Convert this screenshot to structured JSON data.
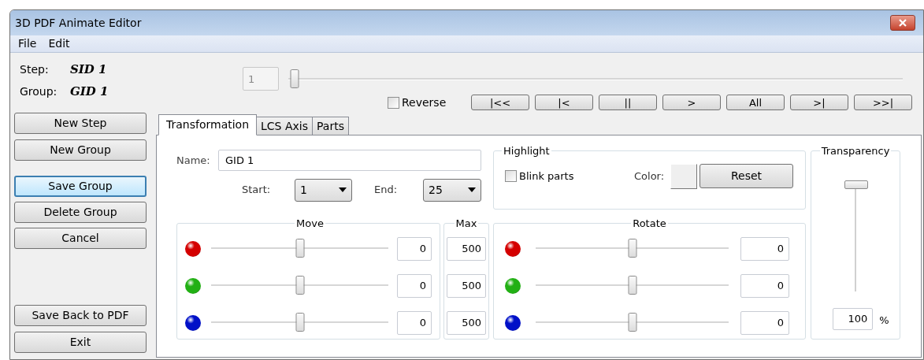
{
  "window": {
    "title": "3D PDF Animate Editor"
  },
  "menu": [
    "File",
    "Edit"
  ],
  "info": [
    {
      "label": "Step:",
      "value": "SID 1"
    },
    {
      "label": "Group:",
      "value": "GID 1"
    }
  ],
  "step": {
    "value": "1",
    "disabled": true,
    "level": 0
  },
  "reverse": {
    "label": "Reverse",
    "checked": false
  },
  "playback_buttons": [
    "|<<",
    "|<",
    "||",
    ">",
    "All",
    ">|",
    ">>|"
  ],
  "actions_top": [
    {
      "label": "New Step",
      "focused": false
    },
    {
      "label": "New Group",
      "focused": false
    }
  ],
  "actions_middle": [
    {
      "label": "Save Group",
      "focused": true
    },
    {
      "label": "Delete Group",
      "focused": false
    },
    {
      "label": "Cancel",
      "focused": false
    }
  ],
  "actions_bottom": [
    {
      "label": "Save Back to PDF",
      "focused": false
    },
    {
      "label": "Exit",
      "focused": false
    }
  ],
  "tabs": [
    {
      "label": "Transformation",
      "selected": true
    },
    {
      "label": "LCS Axis",
      "selected": false
    },
    {
      "label": "Parts",
      "selected": false
    }
  ],
  "name": {
    "label": "Name:",
    "value": "GID 1"
  },
  "start": {
    "label": "Start:",
    "value": "1"
  },
  "end": {
    "label": "End:",
    "value": "25"
  },
  "highlight": {
    "title": "Highlight",
    "blink": {
      "label": "Blink parts",
      "checked": false
    },
    "color_label": "Color:",
    "reset": "Reset"
  },
  "move": {
    "title": "Move",
    "rows": [
      {
        "color": "#d40000",
        "level": 0.5,
        "value": "0"
      },
      {
        "color": "#22b014",
        "level": 0.5,
        "value": "0"
      },
      {
        "color": "#0010c8",
        "level": 0.5,
        "value": "0"
      }
    ]
  },
  "max": {
    "title": "Max",
    "values": [
      "500",
      "500",
      "500"
    ]
  },
  "rotate": {
    "title": "Rotate",
    "rows": [
      {
        "color": "#d40000",
        "level": 0.5,
        "value": "0"
      },
      {
        "color": "#22b014",
        "level": 0.5,
        "value": "0"
      },
      {
        "color": "#0010c8",
        "level": 0.5,
        "value": "0"
      }
    ]
  },
  "transparency": {
    "title": "Transparency",
    "level": 1,
    "value": "100",
    "unit": "%"
  }
}
